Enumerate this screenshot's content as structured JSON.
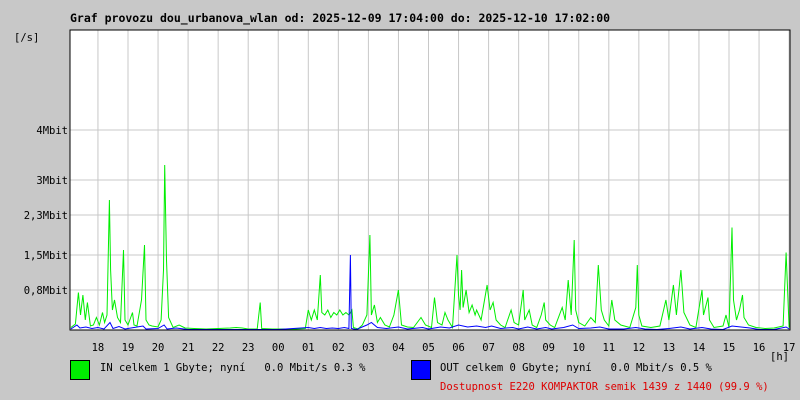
{
  "chart_data": {
    "type": "line",
    "title": "Graf provozu dou_urbanova_wlan od: 2025-12-09 17:04:00 do: 2025-12-10 17:02:00",
    "ylabel": "[/s]",
    "xlabel": "[h]",
    "x_tick_labels": [
      "18",
      "19",
      "20",
      "21",
      "22",
      "23",
      "00",
      "01",
      "02",
      "03",
      "04",
      "05",
      "06",
      "07",
      "08",
      "09",
      "10",
      "11",
      "12",
      "13",
      "14",
      "15",
      "16",
      "17"
    ],
    "y_tick_labels": [
      "0,8Mbit",
      "1,5Mbit",
      "2,3Mbit",
      "3Mbit",
      "4Mbit"
    ],
    "y_tick_values": [
      0.8,
      1.5,
      2.3,
      3.0,
      4.0
    ],
    "ylim": [
      0,
      6.0
    ],
    "xlim": [
      17.07,
      41.03
    ],
    "grid": true,
    "series": [
      {
        "name": "IN",
        "color": "#00ee00",
        "points": [
          [
            17.1,
            0.05
          ],
          [
            17.25,
            0.12
          ],
          [
            17.35,
            0.75
          ],
          [
            17.42,
            0.3
          ],
          [
            17.5,
            0.7
          ],
          [
            17.58,
            0.2
          ],
          [
            17.65,
            0.55
          ],
          [
            17.75,
            0.08
          ],
          [
            17.85,
            0.1
          ],
          [
            17.95,
            0.25
          ],
          [
            18.05,
            0.1
          ],
          [
            18.15,
            0.35
          ],
          [
            18.22,
            0.15
          ],
          [
            18.3,
            0.3
          ],
          [
            18.38,
            2.6
          ],
          [
            18.42,
            1.2
          ],
          [
            18.48,
            0.4
          ],
          [
            18.55,
            0.6
          ],
          [
            18.65,
            0.25
          ],
          [
            18.75,
            0.15
          ],
          [
            18.85,
            1.6
          ],
          [
            18.9,
            0.2
          ],
          [
            19.0,
            0.1
          ],
          [
            19.15,
            0.35
          ],
          [
            19.2,
            0.1
          ],
          [
            19.3,
            0.08
          ],
          [
            19.45,
            0.6
          ],
          [
            19.55,
            1.7
          ],
          [
            19.6,
            0.2
          ],
          [
            19.7,
            0.1
          ],
          [
            19.8,
            0.08
          ],
          [
            20.0,
            0.06
          ],
          [
            20.1,
            0.2
          ],
          [
            20.18,
            1.2
          ],
          [
            20.22,
            3.3
          ],
          [
            20.28,
            1.4
          ],
          [
            20.35,
            0.25
          ],
          [
            20.5,
            0.05
          ],
          [
            20.7,
            0.1
          ],
          [
            20.9,
            0.04
          ],
          [
            21.2,
            0.03
          ],
          [
            21.6,
            0.02
          ],
          [
            22.0,
            0.03
          ],
          [
            22.4,
            0.04
          ],
          [
            22.6,
            0.05
          ],
          [
            22.8,
            0.04
          ],
          [
            23.0,
            0.02
          ],
          [
            23.3,
            0.02
          ],
          [
            23.4,
            0.55
          ],
          [
            23.45,
            0.03
          ],
          [
            23.8,
            0.02
          ],
          [
            24.2,
            0.02
          ],
          [
            24.6,
            0.02
          ],
          [
            24.9,
            0.03
          ],
          [
            25.0,
            0.4
          ],
          [
            25.05,
            0.3
          ],
          [
            25.1,
            0.2
          ],
          [
            25.2,
            0.4
          ],
          [
            25.3,
            0.2
          ],
          [
            25.4,
            1.1
          ],
          [
            25.45,
            0.35
          ],
          [
            25.55,
            0.3
          ],
          [
            25.65,
            0.4
          ],
          [
            25.75,
            0.25
          ],
          [
            25.85,
            0.35
          ],
          [
            25.95,
            0.3
          ],
          [
            26.05,
            0.4
          ],
          [
            26.15,
            0.3
          ],
          [
            26.25,
            0.35
          ],
          [
            26.35,
            0.3
          ],
          [
            26.45,
            0.4
          ],
          [
            26.5,
            0.05
          ],
          [
            26.65,
            0.02
          ],
          [
            26.8,
            0.1
          ],
          [
            26.95,
            0.3
          ],
          [
            27.05,
            1.9
          ],
          [
            27.1,
            0.3
          ],
          [
            27.2,
            0.5
          ],
          [
            27.3,
            0.15
          ],
          [
            27.4,
            0.25
          ],
          [
            27.55,
            0.1
          ],
          [
            27.7,
            0.06
          ],
          [
            27.85,
            0.3
          ],
          [
            28.0,
            0.8
          ],
          [
            28.1,
            0.1
          ],
          [
            28.3,
            0.06
          ],
          [
            28.5,
            0.05
          ],
          [
            28.75,
            0.25
          ],
          [
            28.9,
            0.1
          ],
          [
            29.1,
            0.05
          ],
          [
            29.2,
            0.65
          ],
          [
            29.3,
            0.15
          ],
          [
            29.45,
            0.1
          ],
          [
            29.55,
            0.35
          ],
          [
            29.65,
            0.2
          ],
          [
            29.8,
            0.05
          ],
          [
            29.95,
            1.5
          ],
          [
            30.0,
            0.7
          ],
          [
            30.05,
            0.4
          ],
          [
            30.1,
            1.2
          ],
          [
            30.15,
            0.45
          ],
          [
            30.25,
            0.8
          ],
          [
            30.35,
            0.35
          ],
          [
            30.45,
            0.5
          ],
          [
            30.55,
            0.3
          ],
          [
            30.6,
            0.4
          ],
          [
            30.75,
            0.2
          ],
          [
            30.95,
            0.9
          ],
          [
            31.05,
            0.4
          ],
          [
            31.15,
            0.55
          ],
          [
            31.25,
            0.2
          ],
          [
            31.4,
            0.1
          ],
          [
            31.55,
            0.05
          ],
          [
            31.75,
            0.4
          ],
          [
            31.85,
            0.15
          ],
          [
            32.0,
            0.1
          ],
          [
            32.15,
            0.8
          ],
          [
            32.2,
            0.2
          ],
          [
            32.35,
            0.4
          ],
          [
            32.45,
            0.1
          ],
          [
            32.6,
            0.05
          ],
          [
            32.75,
            0.3
          ],
          [
            32.85,
            0.55
          ],
          [
            32.9,
            0.2
          ],
          [
            33.05,
            0.1
          ],
          [
            33.2,
            0.05
          ],
          [
            33.45,
            0.45
          ],
          [
            33.55,
            0.2
          ],
          [
            33.65,
            1.0
          ],
          [
            33.75,
            0.3
          ],
          [
            33.85,
            1.8
          ],
          [
            33.9,
            0.4
          ],
          [
            34.0,
            0.15
          ],
          [
            34.2,
            0.08
          ],
          [
            34.4,
            0.25
          ],
          [
            34.55,
            0.15
          ],
          [
            34.65,
            1.3
          ],
          [
            34.75,
            0.4
          ],
          [
            34.85,
            0.2
          ],
          [
            35.0,
            0.08
          ],
          [
            35.1,
            0.6
          ],
          [
            35.2,
            0.2
          ],
          [
            35.4,
            0.1
          ],
          [
            35.7,
            0.05
          ],
          [
            35.9,
            0.45
          ],
          [
            35.95,
            1.3
          ],
          [
            36.0,
            0.3
          ],
          [
            36.1,
            0.08
          ],
          [
            36.4,
            0.05
          ],
          [
            36.7,
            0.08
          ],
          [
            36.9,
            0.6
          ],
          [
            37.0,
            0.2
          ],
          [
            37.15,
            0.9
          ],
          [
            37.25,
            0.3
          ],
          [
            37.4,
            1.2
          ],
          [
            37.5,
            0.35
          ],
          [
            37.7,
            0.1
          ],
          [
            37.9,
            0.05
          ],
          [
            38.1,
            0.8
          ],
          [
            38.15,
            0.3
          ],
          [
            38.3,
            0.65
          ],
          [
            38.35,
            0.2
          ],
          [
            38.5,
            0.05
          ],
          [
            38.8,
            0.08
          ],
          [
            38.9,
            0.3
          ],
          [
            39.0,
            0.05
          ],
          [
            39.1,
            2.05
          ],
          [
            39.15,
            0.6
          ],
          [
            39.25,
            0.2
          ],
          [
            39.35,
            0.4
          ],
          [
            39.45,
            0.7
          ],
          [
            39.5,
            0.25
          ],
          [
            39.65,
            0.1
          ],
          [
            39.9,
            0.05
          ],
          [
            40.2,
            0.03
          ],
          [
            40.5,
            0.04
          ],
          [
            40.8,
            0.08
          ],
          [
            40.9,
            1.55
          ],
          [
            41.0,
            0.05
          ]
        ]
      },
      {
        "name": "OUT",
        "color": "#0000ff",
        "points": [
          [
            17.1,
            0.02
          ],
          [
            17.3,
            0.1
          ],
          [
            17.4,
            0.04
          ],
          [
            17.6,
            0.06
          ],
          [
            17.8,
            0.03
          ],
          [
            18.0,
            0.05
          ],
          [
            18.2,
            0.02
          ],
          [
            18.4,
            0.15
          ],
          [
            18.5,
            0.03
          ],
          [
            18.7,
            0.07
          ],
          [
            18.9,
            0.02
          ],
          [
            19.2,
            0.05
          ],
          [
            19.5,
            0.08
          ],
          [
            19.6,
            0.02
          ],
          [
            20.0,
            0.03
          ],
          [
            20.2,
            0.1
          ],
          [
            20.3,
            0.02
          ],
          [
            20.6,
            0.04
          ],
          [
            21.0,
            0.01
          ],
          [
            22.0,
            0.01
          ],
          [
            23.0,
            0.01
          ],
          [
            24.0,
            0.01
          ],
          [
            25.0,
            0.05
          ],
          [
            25.2,
            0.03
          ],
          [
            25.4,
            0.05
          ],
          [
            25.6,
            0.03
          ],
          [
            25.8,
            0.04
          ],
          [
            26.0,
            0.03
          ],
          [
            26.2,
            0.05
          ],
          [
            26.35,
            0.03
          ],
          [
            26.4,
            1.5
          ],
          [
            26.43,
            0.03
          ],
          [
            26.6,
            0.01
          ],
          [
            26.95,
            0.1
          ],
          [
            27.1,
            0.15
          ],
          [
            27.3,
            0.05
          ],
          [
            27.6,
            0.03
          ],
          [
            28.0,
            0.06
          ],
          [
            28.3,
            0.02
          ],
          [
            28.8,
            0.05
          ],
          [
            29.0,
            0.02
          ],
          [
            29.4,
            0.06
          ],
          [
            29.7,
            0.04
          ],
          [
            30.0,
            0.1
          ],
          [
            30.3,
            0.06
          ],
          [
            30.6,
            0.08
          ],
          [
            30.9,
            0.05
          ],
          [
            31.1,
            0.08
          ],
          [
            31.4,
            0.03
          ],
          [
            31.8,
            0.05
          ],
          [
            32.0,
            0.02
          ],
          [
            32.3,
            0.06
          ],
          [
            32.6,
            0.02
          ],
          [
            32.9,
            0.05
          ],
          [
            33.1,
            0.02
          ],
          [
            33.5,
            0.05
          ],
          [
            33.8,
            0.1
          ],
          [
            34.0,
            0.03
          ],
          [
            34.4,
            0.04
          ],
          [
            34.7,
            0.06
          ],
          [
            35.0,
            0.02
          ],
          [
            35.5,
            0.02
          ],
          [
            35.9,
            0.05
          ],
          [
            36.2,
            0.02
          ],
          [
            36.6,
            0.01
          ],
          [
            37.0,
            0.03
          ],
          [
            37.4,
            0.06
          ],
          [
            37.7,
            0.02
          ],
          [
            38.1,
            0.05
          ],
          [
            38.4,
            0.02
          ],
          [
            38.8,
            0.01
          ],
          [
            39.1,
            0.08
          ],
          [
            39.4,
            0.06
          ],
          [
            39.7,
            0.04
          ],
          [
            40.0,
            0.01
          ],
          [
            40.5,
            0.01
          ],
          [
            40.9,
            0.06
          ],
          [
            41.0,
            0.02
          ]
        ]
      }
    ]
  },
  "legend": {
    "in_label": "IN celkem 1 Gbyte; nyní   0.0 Mbit/s 0.3 %",
    "in_color": "#00ee00",
    "out_label": "OUT celkem 0 Gbyte; nyní   0.0 Mbit/s 0.5 %",
    "out_color": "#0000ff"
  },
  "availability": {
    "text": "Dostupnost E220 KOMPAKTOR semik 1439 z 1440 (99.9 %)",
    "color": "#dd0000"
  }
}
